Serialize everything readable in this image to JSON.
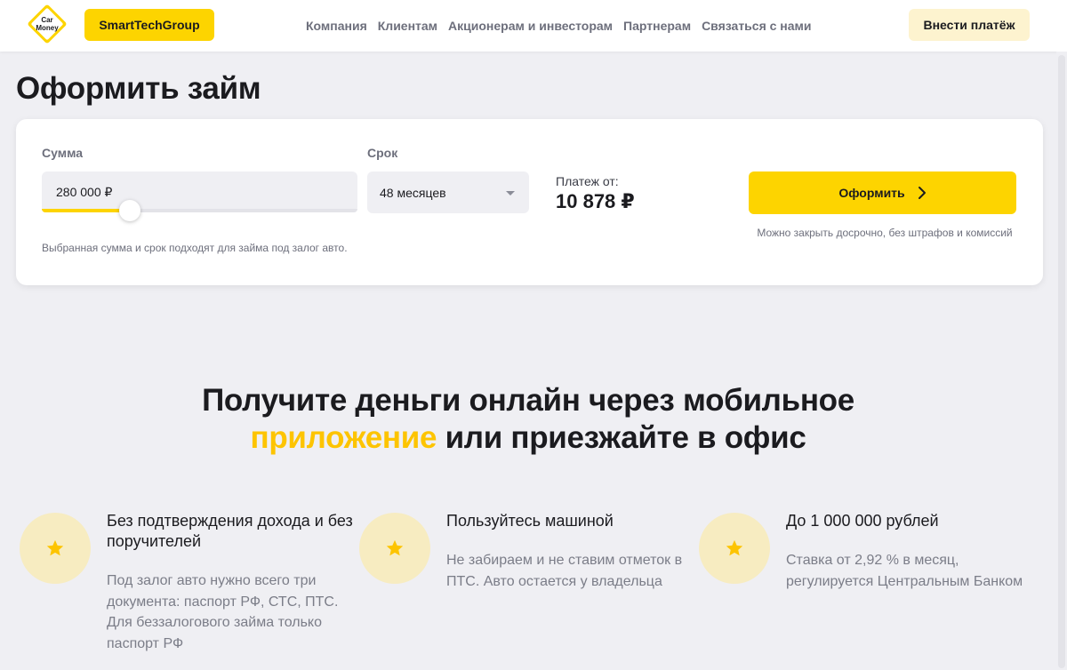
{
  "header": {
    "logo_text": "Car Money",
    "group_button": "SmartTechGroup",
    "nav": [
      "Компания",
      "Клиентам",
      "Акционерам и инвесторам",
      "Партнерам",
      "Связаться с нами"
    ],
    "pay_button": "Внести платёж"
  },
  "page_title": "Оформить займ",
  "calculator": {
    "sum_label": "Сумма",
    "sum_value": "280 000 ₽",
    "sum_slider_fraction": 0.28,
    "term_label": "Срок",
    "term_value": "48 месяцев",
    "payment_label": "Платеж от:",
    "payment_value": "10 878 ₽",
    "submit_label": "Оформить",
    "early_note": "Можно закрыть досрочно, без штрафов и комиссий",
    "hint": "Выбранная сумма и срок подходят для займа под залог авто."
  },
  "headline": {
    "line1": "Получите деньги онлайн через мобильное",
    "line2_accent": "приложение",
    "line2_rest": " или приезжайте в офис"
  },
  "features": [
    {
      "title": "Без подтверждения дохода и без поручителей",
      "desc": "Под залог авто нужно всего три документа: паспорт РФ, СТС, ПТС. Для беззалогового займа только паспорт РФ",
      "icon": "star-icon"
    },
    {
      "title": "Пользуйтесь машиной",
      "desc": "Не забираем и не ставим отметок в ПТС. Авто остается у владельца",
      "icon": "star-icon"
    },
    {
      "title": "До 1 000 000 рублей",
      "desc": "Ставка от 2,92 % в месяц, регулируется Центральным Банком",
      "icon": "star-icon"
    }
  ],
  "colors": {
    "brand_yellow": "#fdd400",
    "accent_text": "#fdc400",
    "icon_circle": "#f7ecc1",
    "page_bg": "#efeff3"
  }
}
